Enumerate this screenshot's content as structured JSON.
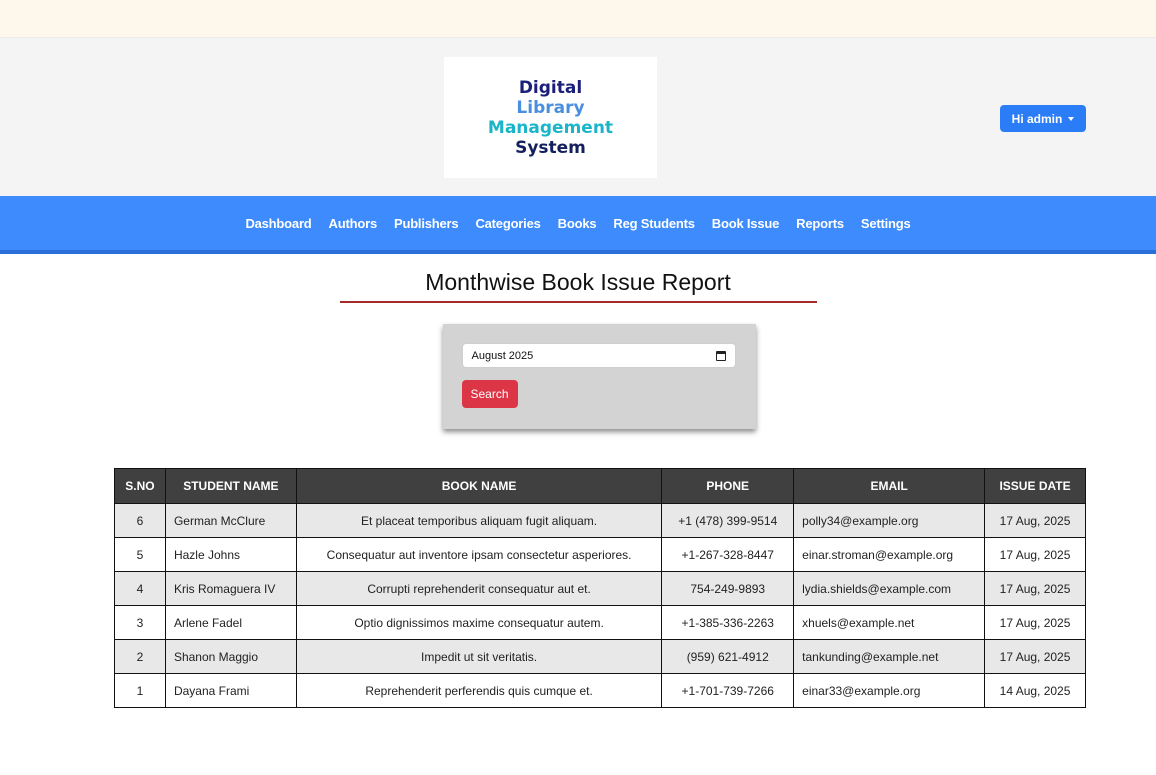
{
  "logo": {
    "line1": "Digital",
    "line2": "Library",
    "line3": "Management",
    "line4": "System"
  },
  "user_menu": {
    "label": "Hi admin"
  },
  "nav": {
    "items": [
      "Dashboard",
      "Authors",
      "Publishers",
      "Categories",
      "Books",
      "Reg Students",
      "Book Issue",
      "Reports",
      "Settings"
    ]
  },
  "page": {
    "title": "Monthwise Book Issue Report"
  },
  "search": {
    "month_value": "August 2025",
    "button_label": "Search"
  },
  "table": {
    "headers": [
      "S.NO",
      "STUDENT NAME",
      "BOOK NAME",
      "PHONE",
      "EMAIL",
      "ISSUE DATE"
    ],
    "rows": [
      [
        "6",
        "German McClure",
        "Et placeat temporibus aliquam fugit aliquam.",
        "+1 (478) 399-9514",
        "polly34@example.org",
        "17 Aug, 2025"
      ],
      [
        "5",
        "Hazle Johns",
        "Consequatur aut inventore ipsam consectetur asperiores.",
        "+1-267-328-8447",
        "einar.stroman@example.org",
        "17 Aug, 2025"
      ],
      [
        "4",
        "Kris Romaguera IV",
        "Corrupti reprehenderit consequatur aut et.",
        "754-249-9893",
        "lydia.shields@example.com",
        "17 Aug, 2025"
      ],
      [
        "3",
        "Arlene Fadel",
        "Optio dignissimos maxime consequatur autem.",
        "+1-385-336-2263",
        "xhuels@example.net",
        "17 Aug, 2025"
      ],
      [
        "2",
        "Shanon Maggio",
        "Impedit ut sit veritatis.",
        "(959) 621-4912",
        "tankunding@example.net",
        "17 Aug, 2025"
      ],
      [
        "1",
        "Dayana Frami",
        "Reprehenderit perferendis quis cumque et.",
        "+1-701-739-7266",
        "einar33@example.org",
        "14 Aug, 2025"
      ]
    ]
  }
}
